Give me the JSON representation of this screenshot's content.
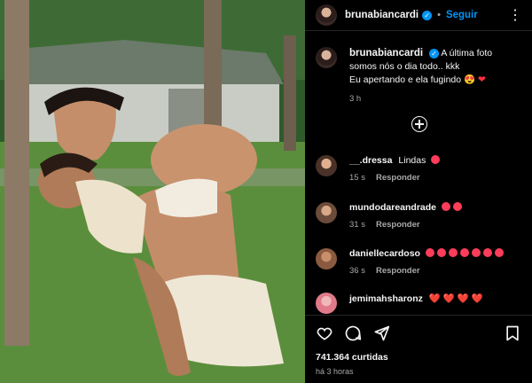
{
  "post": {
    "username": "brunabiancardi",
    "follow_label": "Seguir",
    "caption_line1": "A última foto",
    "caption_line2": "somos nós o dia todo.. kkk",
    "caption_line3": "Eu apertando e ela fugindo",
    "caption_time": "3 h"
  },
  "comments": [
    {
      "user": "__.dressa",
      "text": "Lindas",
      "time": "15 s",
      "reply": "Responder",
      "emoji_count": 1
    },
    {
      "user": "mundodareandrade",
      "text": "",
      "time": "31 s",
      "reply": "Responder",
      "emoji_count": 2
    },
    {
      "user": "daniellecardoso",
      "text": "",
      "time": "36 s",
      "reply": "Responder",
      "emoji_count": 7
    },
    {
      "user": "jemimahsharonz",
      "text": "❤️ ❤️ ❤️ ❤️",
      "time": "",
      "reply": ""
    }
  ],
  "footer": {
    "likes": "741.364 curtidas",
    "ago": "há 3 horas"
  },
  "icons": [
    "more-icon",
    "verified-icon",
    "load-more-icon",
    "heart-icon",
    "comment-icon",
    "share-icon",
    "save-icon"
  ]
}
